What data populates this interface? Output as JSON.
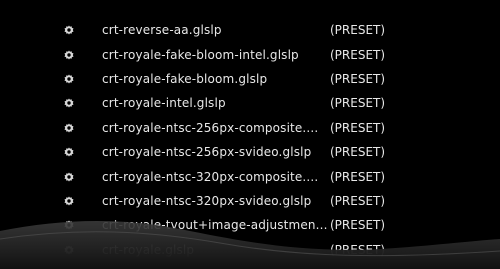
{
  "file_list": {
    "items": [
      {
        "name": "crt-reverse-aa.glslp",
        "type": "(PRESET)",
        "icon": "gear-icon"
      },
      {
        "name": "crt-royale-fake-bloom-intel.glslp",
        "type": "(PRESET)",
        "icon": "gear-icon"
      },
      {
        "name": "crt-royale-fake-bloom.glslp",
        "type": "(PRESET)",
        "icon": "gear-icon"
      },
      {
        "name": "crt-royale-intel.glslp",
        "type": "(PRESET)",
        "icon": "gear-icon"
      },
      {
        "name": "crt-royale-ntsc-256px-composite....",
        "type": "(PRESET)",
        "icon": "gear-icon"
      },
      {
        "name": "crt-royale-ntsc-256px-svideo.glslp",
        "type": "(PRESET)",
        "icon": "gear-icon"
      },
      {
        "name": "crt-royale-ntsc-320px-composite....",
        "type": "(PRESET)",
        "icon": "gear-icon"
      },
      {
        "name": "crt-royale-ntsc-320px-svideo.glslp",
        "type": "(PRESET)",
        "icon": "gear-icon"
      },
      {
        "name": "crt-royale-tvout+image-adjustmen...",
        "type": "(PRESET)",
        "icon": "gear-icon"
      },
      {
        "name": "crt-royale.glslp",
        "type": "(PRESET)",
        "icon": "gear-icon"
      },
      {
        "name": "",
        "type": "",
        "icon": ""
      }
    ]
  },
  "colors": {
    "background": "#000000",
    "text": "#e8e8e8",
    "icon": "#d8d8d8",
    "wave": "#2a2a2a"
  }
}
